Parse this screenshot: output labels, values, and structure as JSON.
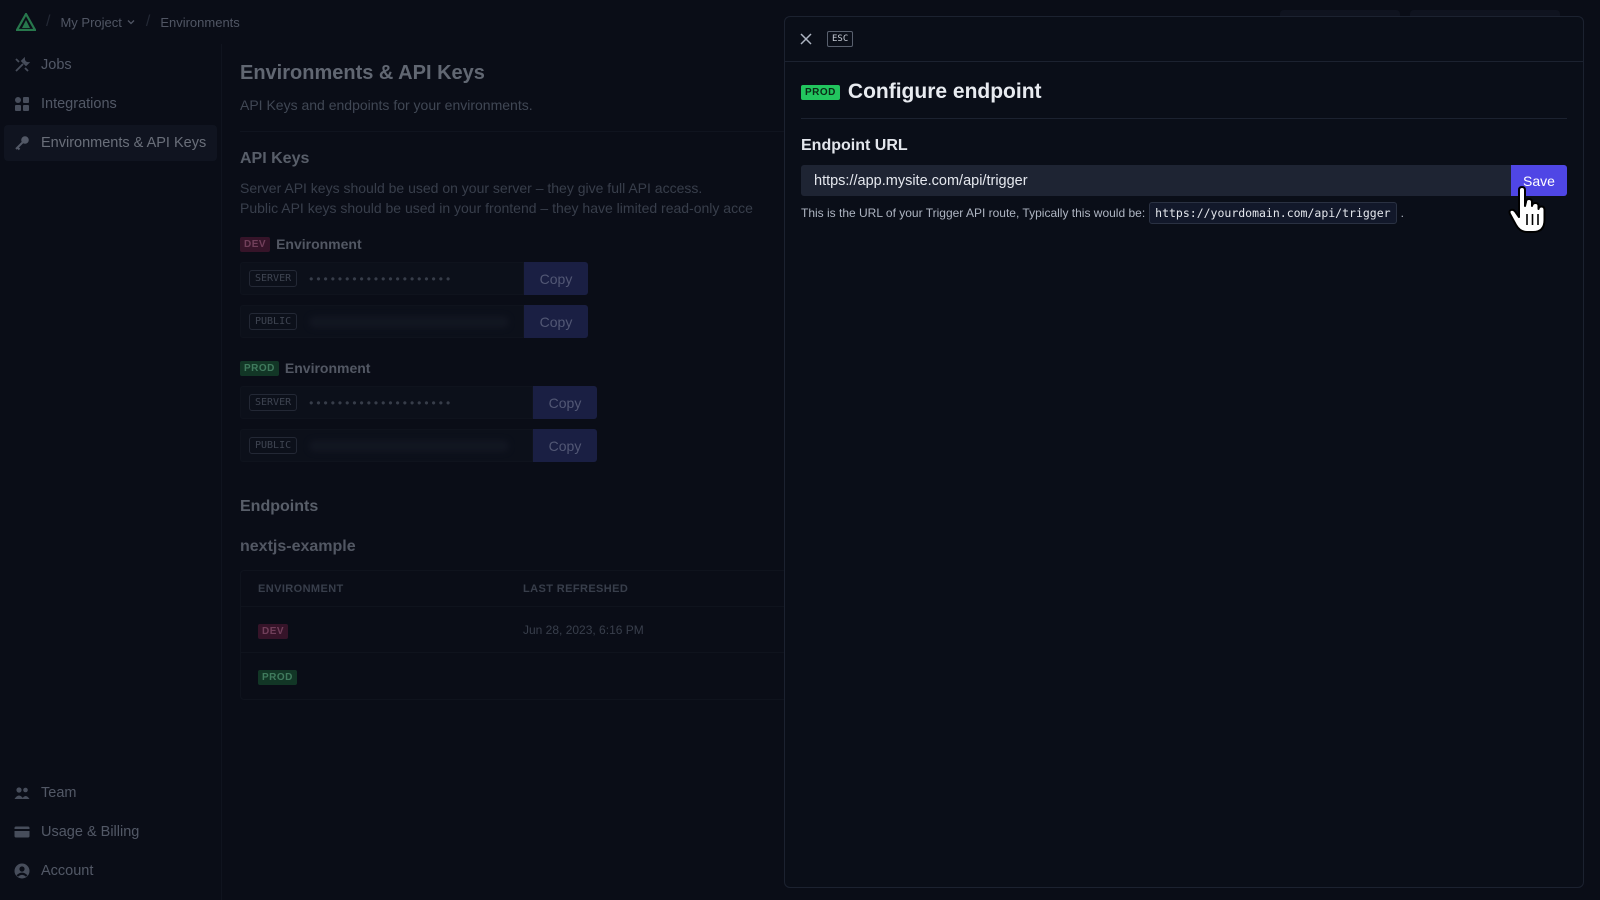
{
  "breadcrumb": {
    "project": "My Project",
    "page": "Environments"
  },
  "sidebar": {
    "items": [
      {
        "label": "Jobs",
        "icon": "tools-icon"
      },
      {
        "label": "Integrations",
        "icon": "grid-icon"
      },
      {
        "label": "Environments & API Keys",
        "icon": "key-icon",
        "active": true
      }
    ],
    "bottom": [
      {
        "label": "Team",
        "icon": "team-icon"
      },
      {
        "label": "Usage & Billing",
        "icon": "card-icon"
      },
      {
        "label": "Account",
        "icon": "user-icon"
      }
    ]
  },
  "main": {
    "title": "Environments & API Keys",
    "subtitle": "API Keys and endpoints for your environments.",
    "api_keys": {
      "heading": "API Keys",
      "desc1": "Server API keys should be used on your server – they give full API access.",
      "desc2": "Public API keys should be used in your frontend – they have limited read-only acce",
      "dev_badge": "DEV",
      "prod_badge": "PROD",
      "env_label": "Environment",
      "server_tag": "SERVER",
      "public_tag": "PUBLIC",
      "mask_dev": "••••••••••••••••••••",
      "mask_prod": "••••••••••••••••••••",
      "copy": "Copy"
    },
    "endpoints": {
      "heading": "Endpoints",
      "name": "nextjs-example",
      "col_env": "ENVIRONMENT",
      "col_refreshed": "LAST REFRESHED",
      "rows": [
        {
          "env": "DEV",
          "refreshed": "Jun 28, 2023, 6:16 PM"
        },
        {
          "env": "PROD",
          "refreshed": ""
        }
      ]
    }
  },
  "panel": {
    "esc": "ESC",
    "badge": "PROD",
    "title": "Configure endpoint",
    "field_label": "Endpoint URL",
    "url_value": "https://app.mysite.com/api/trigger",
    "save": "Save",
    "hint_text": "This is the URL of your Trigger API route, Typically this would be:",
    "hint_code": "https://yourdomain.com/api/trigger",
    "hint_end": "."
  },
  "colors": {
    "accent": "#4f46e5",
    "prod": "#22c55e",
    "dev": "#be185d",
    "bg": "#0b0f1a"
  }
}
